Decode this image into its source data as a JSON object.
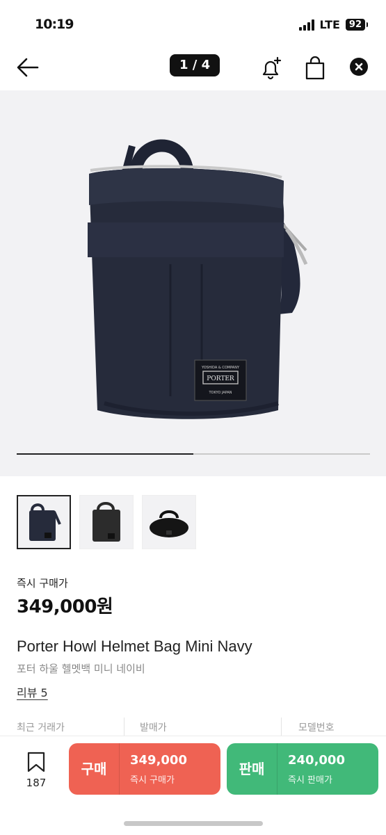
{
  "status": {
    "time": "10:19",
    "network": "LTE",
    "battery": "92"
  },
  "nav": {
    "page_indicator": "1 / 4"
  },
  "gallery": {
    "progress": 0.5,
    "bag_label_top": "YOSHIDA & COMPANY",
    "bag_label_brand": "PORTER",
    "bag_label_bottom": "TOKYO JAPAN"
  },
  "price": {
    "label": "즉시 구매가",
    "value": "349,000원"
  },
  "product": {
    "name": "Porter Howl Helmet Bag Mini Navy",
    "name_ko": "포터 하울 헬멧백 미니 네이비",
    "review_link": "리뷰 5"
  },
  "info": {
    "recent_trade": "최근 거래가",
    "release_price": "발매가",
    "model_number": "모델번호"
  },
  "bottom": {
    "wish_count": "187",
    "buy": {
      "title": "구매",
      "price": "349,000",
      "sub": "즉시 구매가"
    },
    "sell": {
      "title": "판매",
      "price": "240,000",
      "sub": "즉시 판매가"
    }
  },
  "colors": {
    "buy": "#ef6253",
    "sell": "#41b979",
    "bag": "#262b3b"
  }
}
